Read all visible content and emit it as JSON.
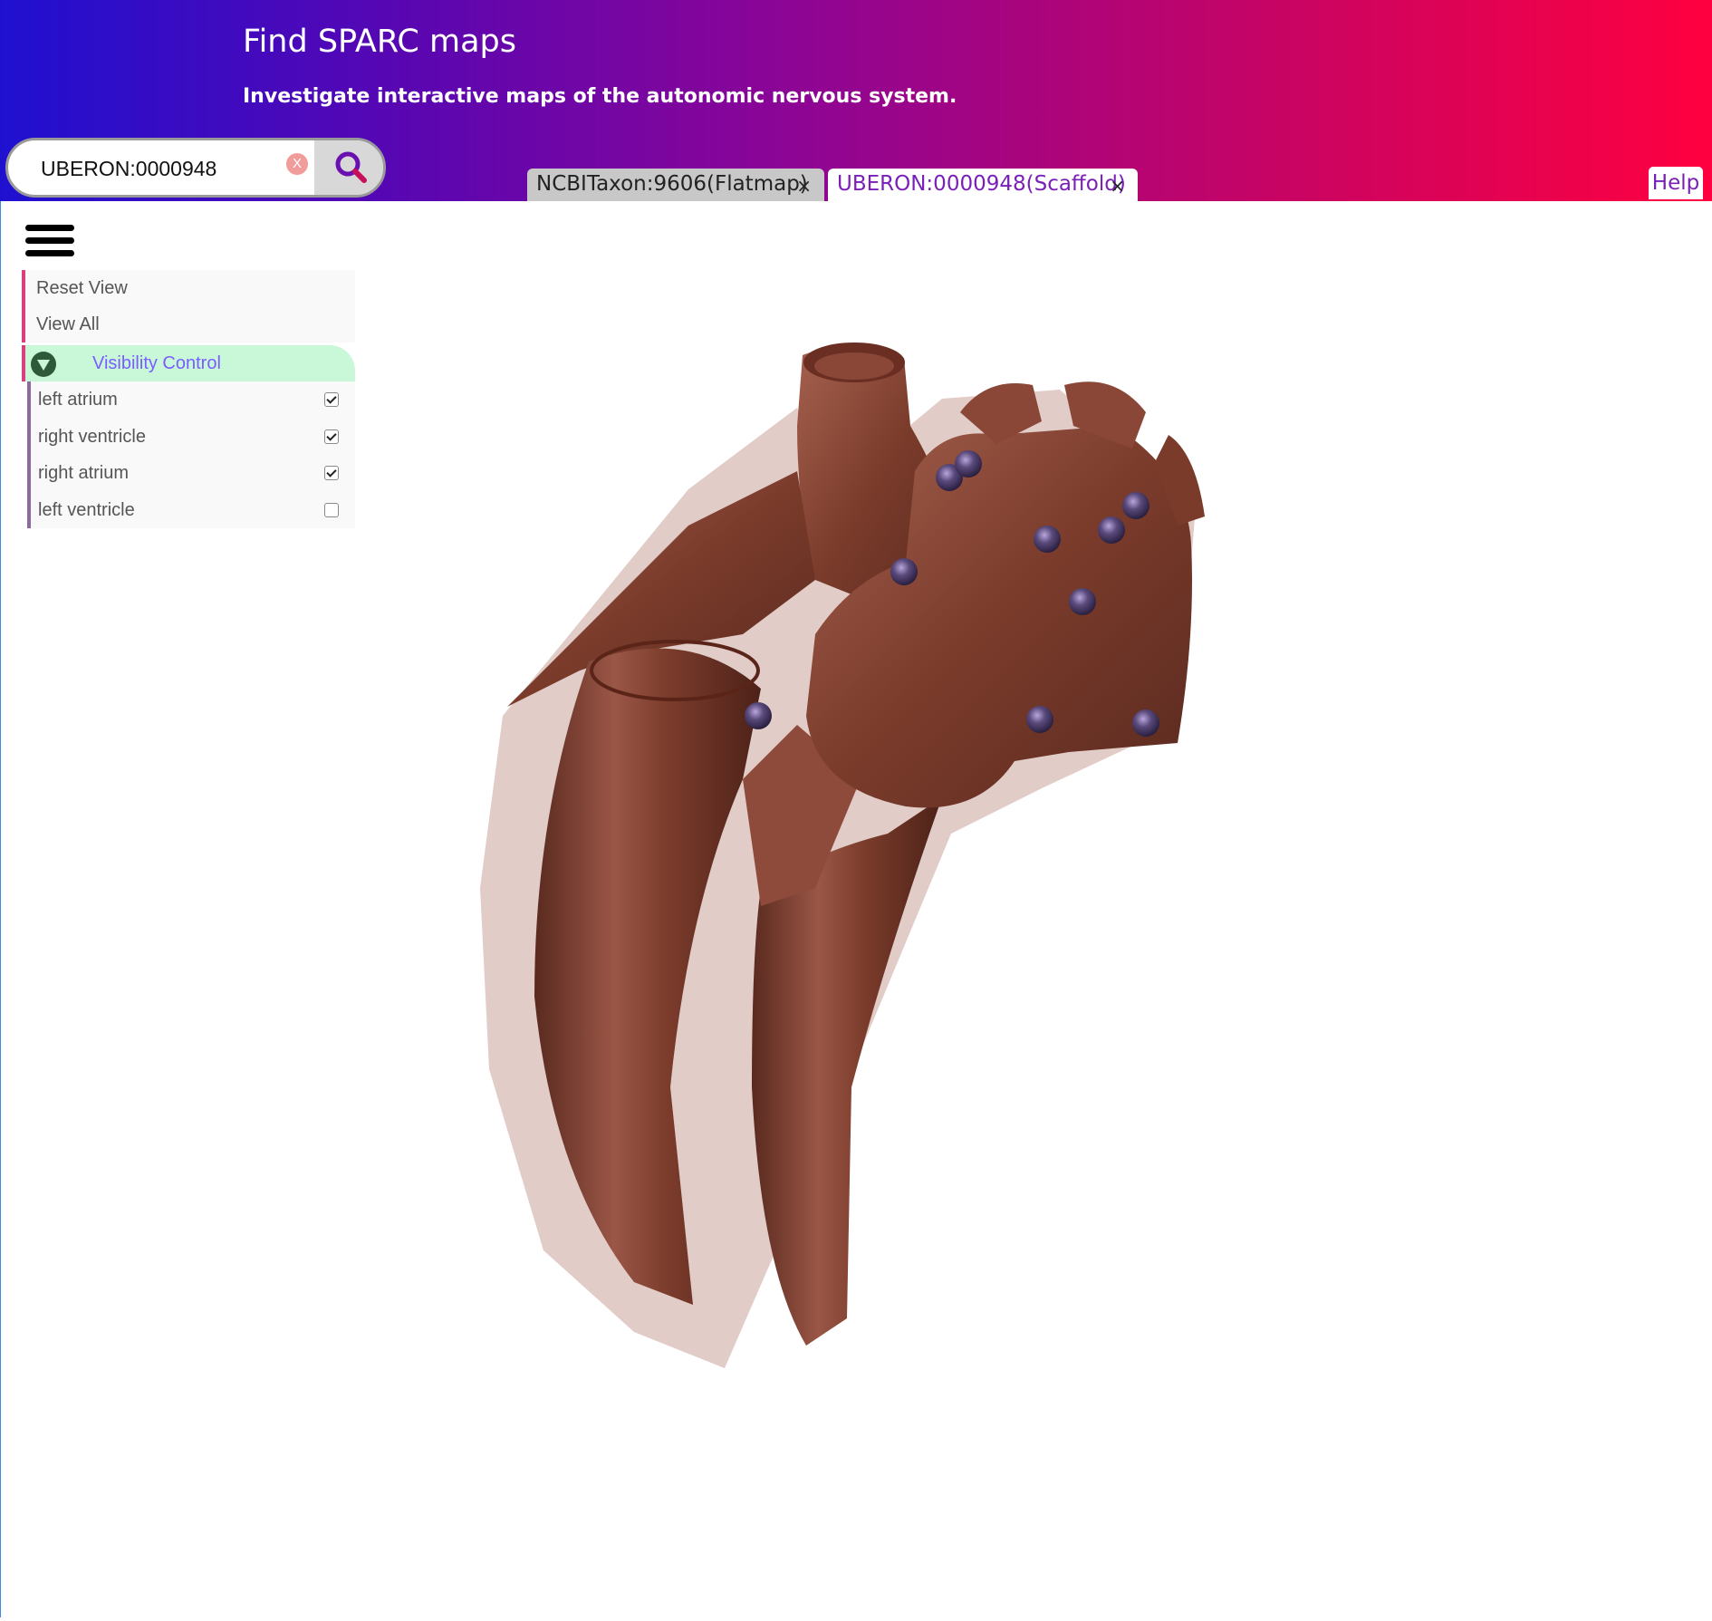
{
  "header": {
    "title": "Find SPARC maps",
    "subtitle": "Investigate interactive maps of the autonomic nervous system."
  },
  "search": {
    "value": "UBERON:0000948",
    "clear_label": "X",
    "clear_icon": "clear-icon",
    "button_icon": "search-icon"
  },
  "tabs": [
    {
      "label": "NCBITaxon:9606(Flatmap)",
      "close": "×",
      "active": false
    },
    {
      "label": "UBERON:0000948(Scaffold)",
      "close": "×",
      "active": true
    }
  ],
  "help": {
    "label": "Help"
  },
  "menu": {
    "icon": "hamburger-menu-icon",
    "items": [
      {
        "label": "Reset View"
      },
      {
        "label": "View All"
      }
    ],
    "visibility": {
      "title": "Visibility Control",
      "items": [
        {
          "label": "left atrium",
          "checked": true
        },
        {
          "label": "right ventricle",
          "checked": true
        },
        {
          "label": "right atrium",
          "checked": true
        },
        {
          "label": "left ventricle",
          "checked": false
        }
      ]
    }
  },
  "scene": {
    "model": "3D heart scaffold",
    "colors": {
      "tissue": "#7a3b2b",
      "marker": "#4a3a66"
    }
  }
}
